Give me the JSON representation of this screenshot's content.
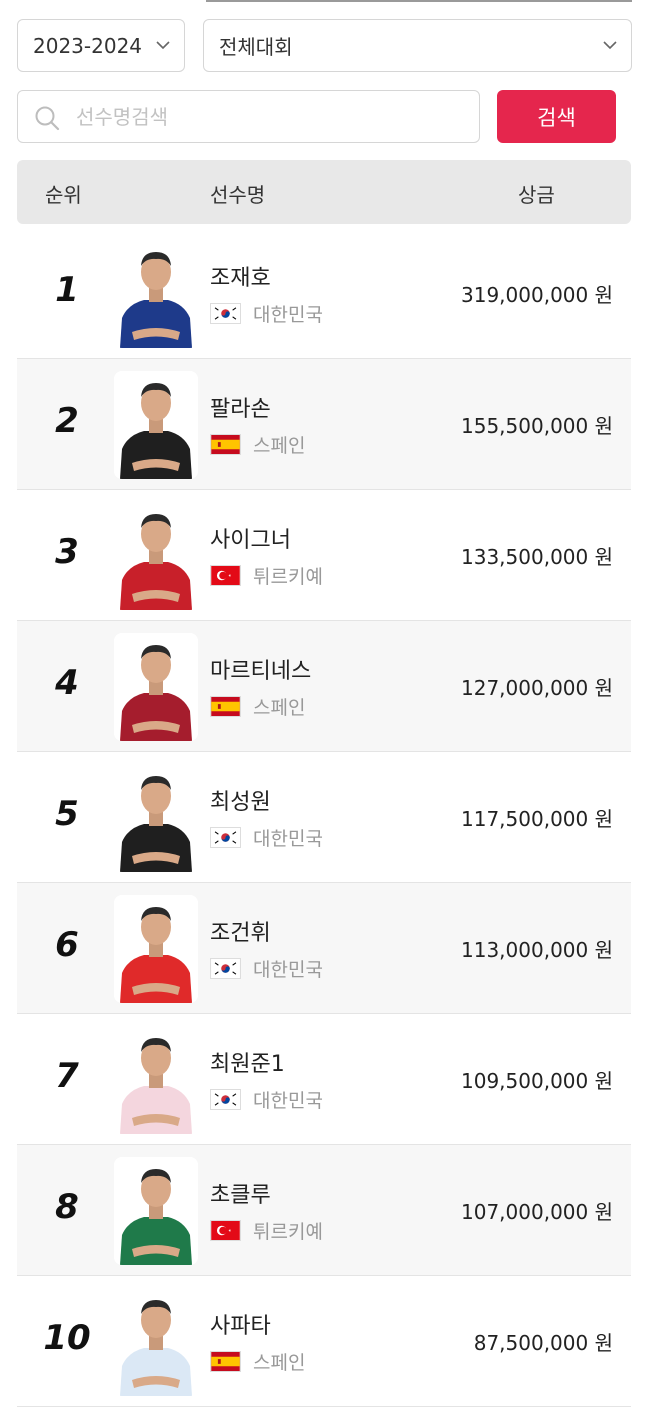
{
  "filters": {
    "season": "2023-2024",
    "event": "전체대회"
  },
  "search": {
    "placeholder": "선수명검색",
    "button_label": "검색"
  },
  "table": {
    "headers": {
      "rank": "순위",
      "name": "선수명",
      "prize": "상금"
    },
    "rows": [
      {
        "rank": "1",
        "name": "조재호",
        "country": "대한민국",
        "flag": "korea",
        "prize": "319,000,000 원",
        "jersey": "navy"
      },
      {
        "rank": "2",
        "name": "팔라손",
        "country": "스페인",
        "flag": "spain",
        "prize": "155,500,000 원",
        "jersey": "black"
      },
      {
        "rank": "3",
        "name": "사이그너",
        "country": "튀르키예",
        "flag": "turkey",
        "prize": "133,500,000 원",
        "jersey": "red"
      },
      {
        "rank": "4",
        "name": "마르티네스",
        "country": "스페인",
        "flag": "spain",
        "prize": "127,000,000 원",
        "jersey": "crimson"
      },
      {
        "rank": "5",
        "name": "최성원",
        "country": "대한민국",
        "flag": "korea",
        "prize": "117,500,000 원",
        "jersey": "black"
      },
      {
        "rank": "6",
        "name": "조건휘",
        "country": "대한민국",
        "flag": "korea",
        "prize": "113,000,000 원",
        "jersey": "brightred"
      },
      {
        "rank": "7",
        "name": "최원준1",
        "country": "대한민국",
        "flag": "korea",
        "prize": "109,500,000 원",
        "jersey": "pink"
      },
      {
        "rank": "8",
        "name": "초클루",
        "country": "튀르키예",
        "flag": "turkey",
        "prize": "107,000,000 원",
        "jersey": "green"
      },
      {
        "rank": "10",
        "name": "사파타",
        "country": "스페인",
        "flag": "spain",
        "prize": "87,500,000 원",
        "jersey": "lightblue"
      }
    ]
  },
  "colors": {
    "accent": "#e5264d",
    "header_bg": "#e8e8e8",
    "alt_row_bg": "#f7f7f7",
    "jerseys": {
      "navy": "#1e3a8a",
      "black": "#1f1f1f",
      "red": "#c8202a",
      "crimson": "#a51d2d",
      "brightred": "#e02a2a",
      "pink": "#f4d6de",
      "green": "#1f7a4a",
      "lightblue": "#dbe8f5"
    }
  }
}
